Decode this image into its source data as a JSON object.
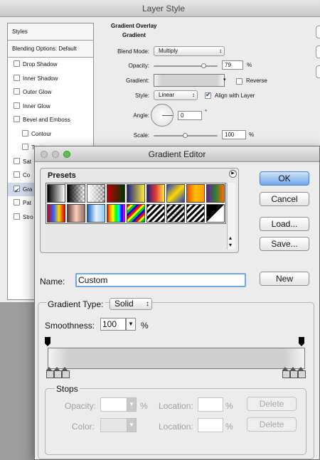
{
  "layer_style": {
    "title": "Layer Style",
    "styles_header": "Styles",
    "blending_options": "Blending Options: Default",
    "effects": [
      {
        "label": "Drop Shadow",
        "checked": false,
        "sub": false
      },
      {
        "label": "Inner Shadow",
        "checked": false,
        "sub": false
      },
      {
        "label": "Outer Glow",
        "checked": false,
        "sub": false
      },
      {
        "label": "Inner Glow",
        "checked": false,
        "sub": false
      },
      {
        "label": "Bevel and Emboss",
        "checked": false,
        "sub": false
      },
      {
        "label": "Contour",
        "checked": false,
        "sub": true
      },
      {
        "label": "Texture",
        "checked": false,
        "sub": true
      },
      {
        "label": "Sat",
        "checked": false,
        "sub": false
      },
      {
        "label": "Co",
        "checked": false,
        "sub": false
      },
      {
        "label": "Gra",
        "checked": true,
        "sub": false,
        "selected": true
      },
      {
        "label": "Pat",
        "checked": false,
        "sub": false
      },
      {
        "label": "Stro",
        "checked": false,
        "sub": false
      }
    ],
    "overlay": {
      "title": "Gradient Overlay",
      "subtitle": "Gradient",
      "blend_mode_label": "Blend Mode:",
      "blend_mode_value": "Multiply",
      "opacity_label": "Opacity:",
      "opacity_value": "79",
      "opacity_fraction": 0.79,
      "pct": "%",
      "gradient_label": "Gradient:",
      "reverse_label": "Reverse",
      "style_label": "Style:",
      "style_value": "Linear",
      "align_label": "Align with Layer",
      "angle_label": "Angle:",
      "angle_value": "0",
      "degree": "°",
      "scale_label": "Scale:",
      "scale_value": "100",
      "scale_fraction": 0.5
    }
  },
  "gradient_editor": {
    "title": "Gradient Editor",
    "presets_label": "Presets",
    "ok_label": "OK",
    "cancel_label": "Cancel",
    "load_label": "Load...",
    "save_label": "Save...",
    "name_label": "Name:",
    "name_value": "Custom",
    "new_label": "New",
    "gradient_type_label": "Gradient Type:",
    "gradient_type_value": "Solid",
    "smoothness_label": "Smoothness:",
    "smoothness_value": "100",
    "pct": "%",
    "stops_label": "Stops",
    "opacity_label": "Opacity:",
    "color_label": "Color:",
    "location_label": "Location:",
    "delete_label": "Delete",
    "colors": {
      "accent": "#6fa8eb",
      "panel": "#ececec"
    }
  }
}
